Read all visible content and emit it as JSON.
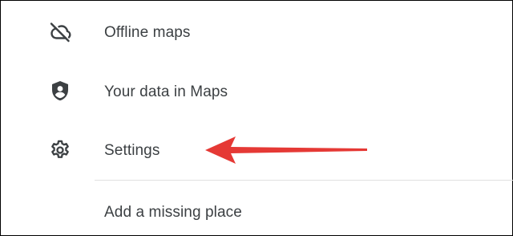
{
  "menu": {
    "items": [
      {
        "label": "Offline maps",
        "icon": "cloud-off-icon"
      },
      {
        "label": "Your data in Maps",
        "icon": "shield-person-icon"
      },
      {
        "label": "Settings",
        "icon": "gear-icon"
      },
      {
        "label": "Add a missing place",
        "icon": ""
      }
    ]
  },
  "colors": {
    "text": "#3c4043",
    "icon": "#3c4043",
    "divider": "#e0e0e0",
    "arrow": "#e53935"
  }
}
